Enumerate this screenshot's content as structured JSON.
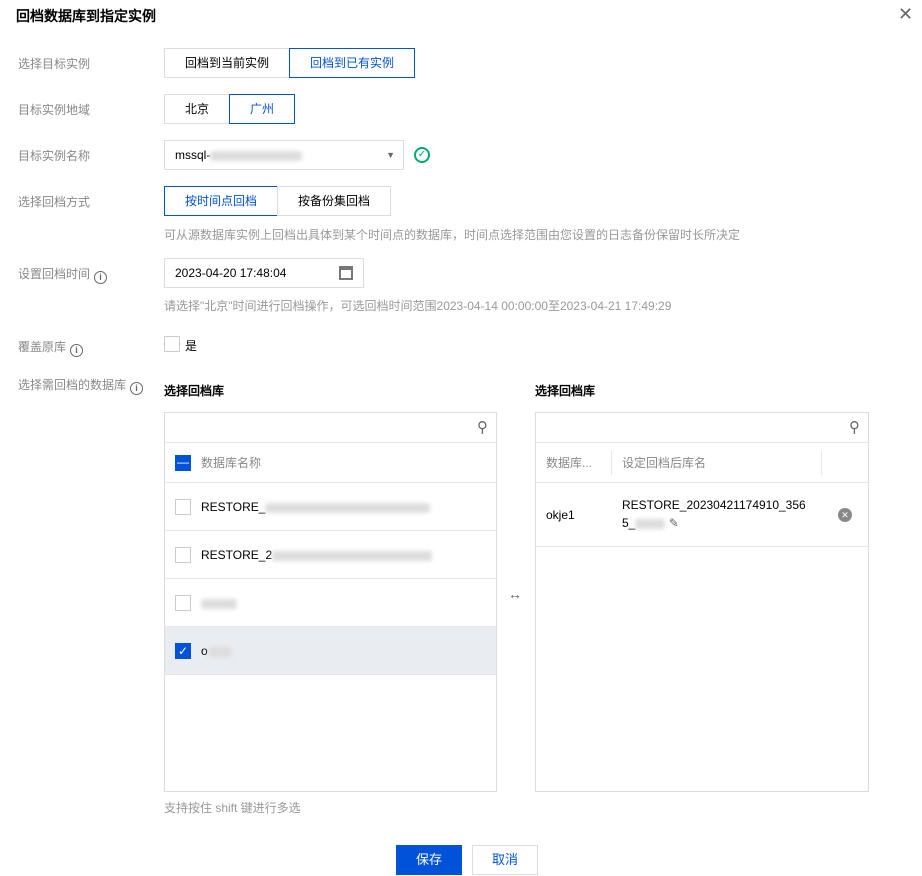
{
  "dialog": {
    "title": "回档数据库到指定实例",
    "close": "✕"
  },
  "fields": {
    "target_instance": {
      "label": "选择目标实例",
      "options": [
        "回档到当前实例",
        "回档到已有实例"
      ],
      "selected": 1
    },
    "region": {
      "label": "目标实例地域",
      "options": [
        "北京",
        "广州"
      ],
      "selected": 1
    },
    "instance_name": {
      "label": "目标实例名称",
      "value": "mssql-"
    },
    "mode": {
      "label": "选择回档方式",
      "options": [
        "按时间点回档",
        "按备份集回档"
      ],
      "selected": 0,
      "hint": "可从源数据库实例上回档出具体到某个时间点的数据库，时间点选择范围由您设置的日志备份保留时长所决定"
    },
    "time": {
      "label": "设置回档时间",
      "value": "2023-04-20 17:48:04",
      "hint": "请选择\"北京\"时间进行回档操作，可选回档时间范围2023-04-14 00:00:00至2023-04-21 17:49:29"
    },
    "overwrite": {
      "label": "覆盖原库",
      "option": "是"
    },
    "databases": {
      "label": "选择需回档的数据库"
    }
  },
  "left": {
    "title": "选择回档库",
    "header": "数据库名称",
    "items": [
      {
        "name": "RESTORE_",
        "checked": false
      },
      {
        "name": "RESTORE_2",
        "checked": false
      },
      {
        "name": "",
        "checked": false
      },
      {
        "name": "o",
        "checked": true
      }
    ]
  },
  "right": {
    "title": "选择回档库",
    "col1": "数据库...",
    "col2": "设定回档后库名",
    "rows": [
      {
        "db": "okje1",
        "new_name": "RESTORE_20230421174910_356",
        "new_name_2": "5_"
      }
    ]
  },
  "shift_hint": "支持按住 shift 键进行多选",
  "buttons": {
    "save": "保存",
    "cancel": "取消"
  },
  "colors": {
    "primary": "#0052d9",
    "success": "#00a870"
  }
}
